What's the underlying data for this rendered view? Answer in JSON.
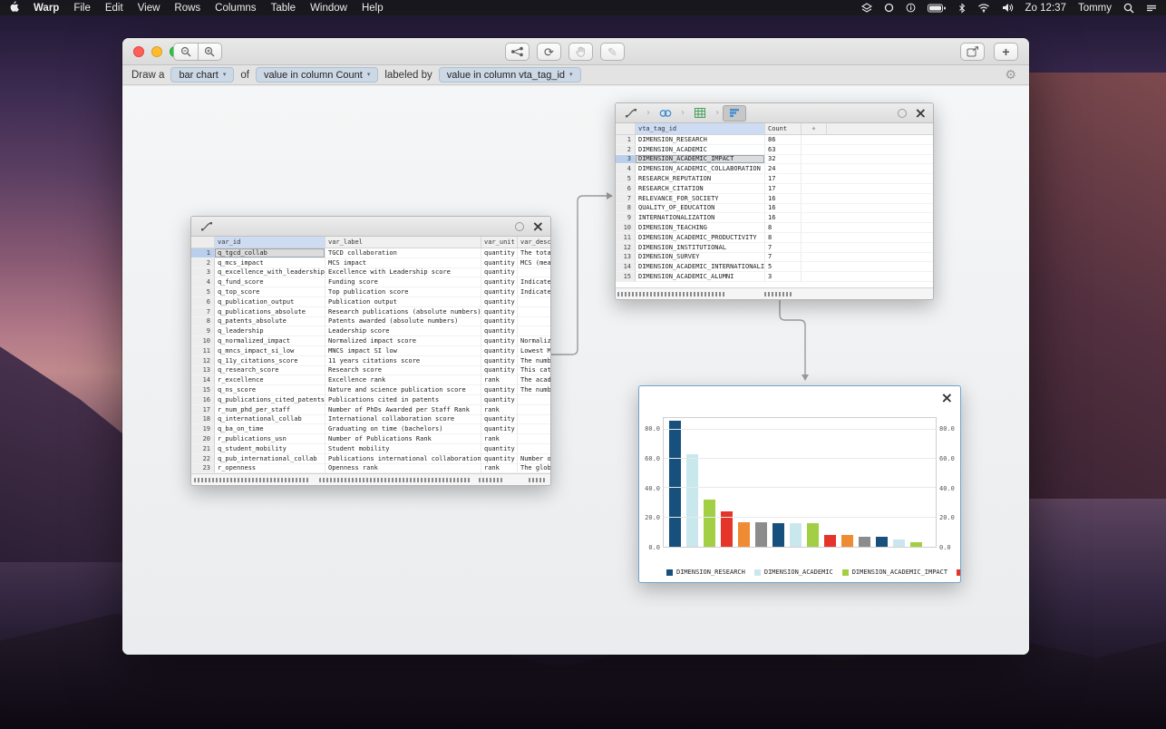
{
  "icons": {
    "close": "×",
    "plus": "+",
    "caret": "▾",
    "chevron": "›",
    "gear": "⚙",
    "pencil": "✎",
    "refresh": "⟳"
  },
  "menubar": {
    "app_name": "Warp",
    "menus": [
      "File",
      "Edit",
      "View",
      "Rows",
      "Columns",
      "Table",
      "Window",
      "Help"
    ],
    "clock": "Zo 12:37",
    "user": "Tommy"
  },
  "formula_bar": {
    "draw_a": "Draw a",
    "chart_type_value": "bar chart",
    "of": "of",
    "value_column_value": "value in column Count",
    "labeled_by": "labeled by",
    "label_column_value": "value in column vta_tag_id"
  },
  "variables_panel": {
    "columns": [
      "var_id",
      "var_label",
      "var_unit",
      "var_descri"
    ],
    "selected_row": 1,
    "rows": [
      {
        "var_id": "q_tgcd_collab",
        "var_label": "TGCD collaboration",
        "var_unit": "quantity",
        "var_descri": "The total g"
      },
      {
        "var_id": "q_mcs_impact",
        "var_label": "MCS impact",
        "var_unit": "quantity",
        "var_descri": "MCS (mean c"
      },
      {
        "var_id": "q_excellence_with_leadership",
        "var_label": "Excellence with Leadership score",
        "var_unit": "quantity",
        "var_descri": ""
      },
      {
        "var_id": "q_fund_score",
        "var_label": "Funding score",
        "var_unit": "quantity",
        "var_descri": "Indicates t"
      },
      {
        "var_id": "q_top_score",
        "var_label": "Top publication score",
        "var_unit": "quantity",
        "var_descri": "Indicates t"
      },
      {
        "var_id": "q_publication_output",
        "var_label": "Publication output",
        "var_unit": "quantity",
        "var_descri": ""
      },
      {
        "var_id": "q_publications_absolute",
        "var_label": "Research publications (absolute numbers)",
        "var_unit": "quantity",
        "var_descri": ""
      },
      {
        "var_id": "q_patents_absolute",
        "var_label": "Patents awarded (absolute numbers)",
        "var_unit": "quantity",
        "var_descri": ""
      },
      {
        "var_id": "q_leadership",
        "var_label": "Leadership score",
        "var_unit": "quantity",
        "var_descri": ""
      },
      {
        "var_id": "q_normalized_impact",
        "var_label": "Normalized impact score",
        "var_unit": "quantity",
        "var_descri": "Normalized"
      },
      {
        "var_id": "q_mncs_impact_si_low",
        "var_label": "MNCS impact SI low",
        "var_unit": "quantity",
        "var_descri": "Lowest MNCS"
      },
      {
        "var_id": "q_11y_citations_score",
        "var_label": "11 years citations score",
        "var_unit": "quantity",
        "var_descri": "The number"
      },
      {
        "var_id": "q_research_score",
        "var_label": "Research score",
        "var_unit": "quantity",
        "var_descri": "This catego"
      },
      {
        "var_id": "r_excellence",
        "var_label": "Excellence rank",
        "var_unit": "rank",
        "var_descri": "The academi"
      },
      {
        "var_id": "q_ns_score",
        "var_label": "Nature and science publication score",
        "var_unit": "quantity",
        "var_descri": "The number"
      },
      {
        "var_id": "q_publications_cited_patents",
        "var_label": "Publications cited in patents",
        "var_unit": "quantity",
        "var_descri": ""
      },
      {
        "var_id": "r_num_phd_per_staff",
        "var_label": "Number of PhDs Awarded per Staff Rank",
        "var_unit": "rank",
        "var_descri": ""
      },
      {
        "var_id": "q_international_collab",
        "var_label": "International collaboration score",
        "var_unit": "quantity",
        "var_descri": ""
      },
      {
        "var_id": "q_ba_on_time",
        "var_label": "Graduating on time (bachelors)",
        "var_unit": "quantity",
        "var_descri": ""
      },
      {
        "var_id": "r_publications_usn",
        "var_label": "Number of Publications Rank",
        "var_unit": "rank",
        "var_descri": ""
      },
      {
        "var_id": "q_student_mobility",
        "var_label": "Student mobility",
        "var_unit": "quantity",
        "var_descri": ""
      },
      {
        "var_id": "q_pub_international_collab",
        "var_label": "Publications international collaboration",
        "var_unit": "quantity",
        "var_descri": "Number of p"
      },
      {
        "var_id": "r_openness",
        "var_label": "Openness rank",
        "var_unit": "rank",
        "var_descri": "The global"
      }
    ]
  },
  "tags_panel": {
    "columns": [
      "vta_tag_id",
      "Count",
      "+"
    ],
    "selected_row": 3,
    "rows": [
      {
        "vta_tag_id": "DIMENSION_RESEARCH",
        "count": "86"
      },
      {
        "vta_tag_id": "DIMENSION_ACADEMIC",
        "count": "63"
      },
      {
        "vta_tag_id": "DIMENSION_ACADEMIC_IMPACT",
        "count": "32"
      },
      {
        "vta_tag_id": "DIMENSION_ACADEMIC_COLLABORATION",
        "count": "24"
      },
      {
        "vta_tag_id": "RESEARCH_REPUTATION",
        "count": "17"
      },
      {
        "vta_tag_id": "RESEARCH_CITATION",
        "count": "17"
      },
      {
        "vta_tag_id": "RELEVANCE_FOR_SOCIETY",
        "count": "16"
      },
      {
        "vta_tag_id": "QUALITY_OF_EDUCATION",
        "count": "16"
      },
      {
        "vta_tag_id": "INTERNATIONALIZATION",
        "count": "16"
      },
      {
        "vta_tag_id": "DIMENSION_TEACHING",
        "count": "8"
      },
      {
        "vta_tag_id": "DIMENSION_ACADEMIC_PRODUCTIVITY",
        "count": "8"
      },
      {
        "vta_tag_id": "DIMENSION_INSTITUTIONAL",
        "count": "7"
      },
      {
        "vta_tag_id": "DIMENSION_SURVEY",
        "count": "7"
      },
      {
        "vta_tag_id": "DIMENSION_ACADEMIC_INTERNATIONALIZATI",
        "count": "5"
      },
      {
        "vta_tag_id": "DIMENSION_ACADEMIC_ALUMNI",
        "count": "3"
      }
    ]
  },
  "chart_panel": {
    "chart_data": {
      "type": "bar",
      "categories": [
        "DIMENSION_RESEARCH",
        "DIMENSION_ACADEMIC",
        "DIMENSION_ACADEMIC_IMPACT",
        "DIMENSION_ACADEMIC_COLLABORATION",
        "RESEARCH_REPUTATION",
        "RESEARCH_CITATION",
        "RELEVANCE_FOR_SOCIETY",
        "QUALITY_OF_EDUCATION",
        "INTERNATIONALIZATION",
        "DIMENSION_TEACHING",
        "DIMENSION_ACADEMIC_PRODUCTIVITY",
        "DIMENSION_INSTITUTIONAL",
        "DIMENSION_SURVEY",
        "DIMENSION_ACADEMIC_INTERNATIONALIZATION",
        "DIMENSION_ACADEMIC_ALUMNI"
      ],
      "values": [
        86,
        63,
        32,
        24,
        17,
        17,
        16,
        16,
        16,
        8,
        8,
        7,
        7,
        5,
        3
      ],
      "title": "",
      "xlabel": "",
      "ylabel": "",
      "ylim": [
        0,
        88
      ],
      "yticks": [
        0,
        20,
        40,
        60,
        80
      ],
      "ytick_labels": [
        "0.0",
        "20.0",
        "40.0",
        "60.0",
        "80.0"
      ],
      "palette": [
        "#17507c",
        "#c9e8ee",
        "#a2cf44",
        "#e5352b",
        "#ef8b33",
        "#8c8c8c"
      ],
      "legend": [
        "DIMENSION_RESEARCH",
        "DIMENSION_ACADEMIC",
        "DIMENSION_ACADEMIC_IMPACT",
        "DIMENSION_ACADEMIC_COLLABORATION"
      ],
      "legend_position": "bottom"
    }
  }
}
